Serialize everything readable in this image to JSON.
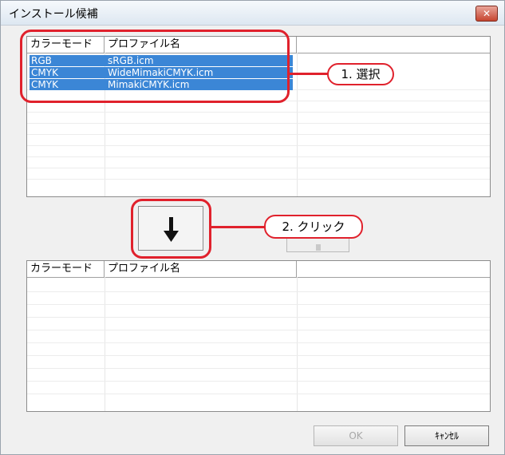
{
  "window": {
    "title": "インストール候補",
    "close_label": "✕"
  },
  "top_list": {
    "columns": [
      "カラーモード",
      "プロファイル名",
      ""
    ],
    "rows": [
      {
        "mode": "RGB",
        "profile": "sRGB.icm"
      },
      {
        "mode": "CMYK",
        "profile": "WideMimakiCMYK.icm"
      },
      {
        "mode": "CMYK",
        "profile": "MimakiCMYK.icm"
      }
    ]
  },
  "bottom_list": {
    "columns": [
      "カラーモード",
      "プロファイル名",
      ""
    ]
  },
  "annotations": {
    "step1": "1. 選択",
    "step2": "2. クリック"
  },
  "buttons": {
    "add_arrow": "↓",
    "ok": "OK",
    "cancel": "ｷｬﾝｾﾙ"
  },
  "colors": {
    "annotation_red": "#e0212c",
    "selection_blue": "#3b86d6"
  }
}
